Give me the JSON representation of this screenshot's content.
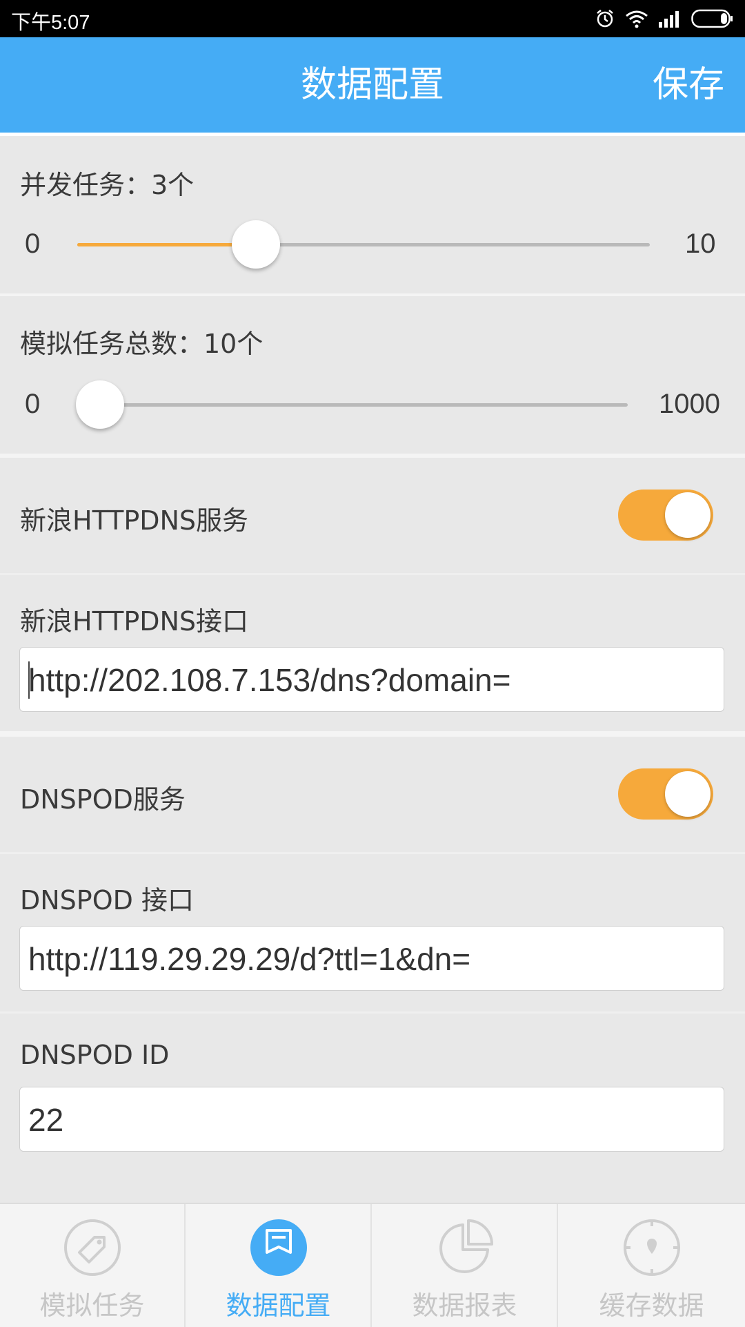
{
  "status_bar": {
    "time": "下午5:07"
  },
  "app_bar": {
    "title": "数据配置",
    "save_label": "保存"
  },
  "concurrent": {
    "label": "并发任务：3个",
    "min": "0",
    "max": "10",
    "value": 3,
    "range": [
      0,
      10
    ]
  },
  "total": {
    "label": "模拟任务总数：10个",
    "min": "0",
    "max": "1000",
    "value": 10,
    "range": [
      0,
      1000
    ]
  },
  "sina_service": {
    "label": "新浪HTTPDNS服务",
    "enabled": true
  },
  "sina_api": {
    "label": "新浪HTTPDNS接口",
    "value": "http://202.108.7.153/dns?domain="
  },
  "dnspod_service": {
    "label": "DNSPOD服务",
    "enabled": true
  },
  "dnspod_api": {
    "label": "DNSPOD 接口",
    "value": "http://119.29.29.29/d?ttl=1&dn="
  },
  "dnspod_id": {
    "label": "DNSPOD ID",
    "value": "22"
  },
  "bottom_nav": {
    "items": [
      {
        "label": "模拟任务",
        "icon": "tag-icon",
        "active": false
      },
      {
        "label": "数据配置",
        "icon": "bookmark-icon",
        "active": true
      },
      {
        "label": "数据报表",
        "icon": "pie-chart-icon",
        "active": false
      },
      {
        "label": "缓存数据",
        "icon": "compass-icon",
        "active": false
      }
    ]
  },
  "colors": {
    "accent": "#45acf5",
    "toggle_on": "#f6a93b",
    "background": "#e8e8e8"
  }
}
